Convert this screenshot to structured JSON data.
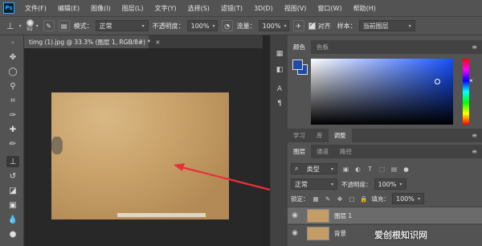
{
  "app": {
    "logo": "Ps"
  },
  "menu": [
    "文件(F)",
    "编辑(E)",
    "图像(I)",
    "图层(L)",
    "文字(Y)",
    "选择(S)",
    "滤镜(T)",
    "3D(D)",
    "视图(V)",
    "窗口(W)",
    "帮助(H)"
  ],
  "options": {
    "brush_size": "92",
    "mode_label": "模式：",
    "mode_value": "正常",
    "opacity_label": "不透明度：",
    "opacity_value": "100%",
    "flow_label": "流量：",
    "flow_value": "100%",
    "align_label": "对齐",
    "sample_label": "样本：",
    "sample_value": "当前图层"
  },
  "document": {
    "tab_title": "timg (1).jpg @ 33.3% (图层 1, RGB/8#) *",
    "close": "×"
  },
  "panels": {
    "color_tabs": [
      "颜色",
      "色板"
    ],
    "adjust_tabs": [
      "学习",
      "库",
      "调整"
    ],
    "layer_tabs": [
      "图层",
      "通道",
      "路径"
    ],
    "filter_kind": "类型",
    "blend_mode": "正常",
    "opacity_label": "不透明度：",
    "opacity_value": "100%",
    "lock_label": "锁定：",
    "fill_label": "填充：",
    "fill_value": "100%",
    "menu_icon": "≡"
  },
  "layers": [
    {
      "name": "图层 1",
      "selected": true
    },
    {
      "name": "背景",
      "selected": false
    }
  ],
  "colors": {
    "foreground": "#1f4ba6",
    "background": "#1f4ba6",
    "arrow": "#e8303a"
  },
  "watermark": "爱创根知识网"
}
